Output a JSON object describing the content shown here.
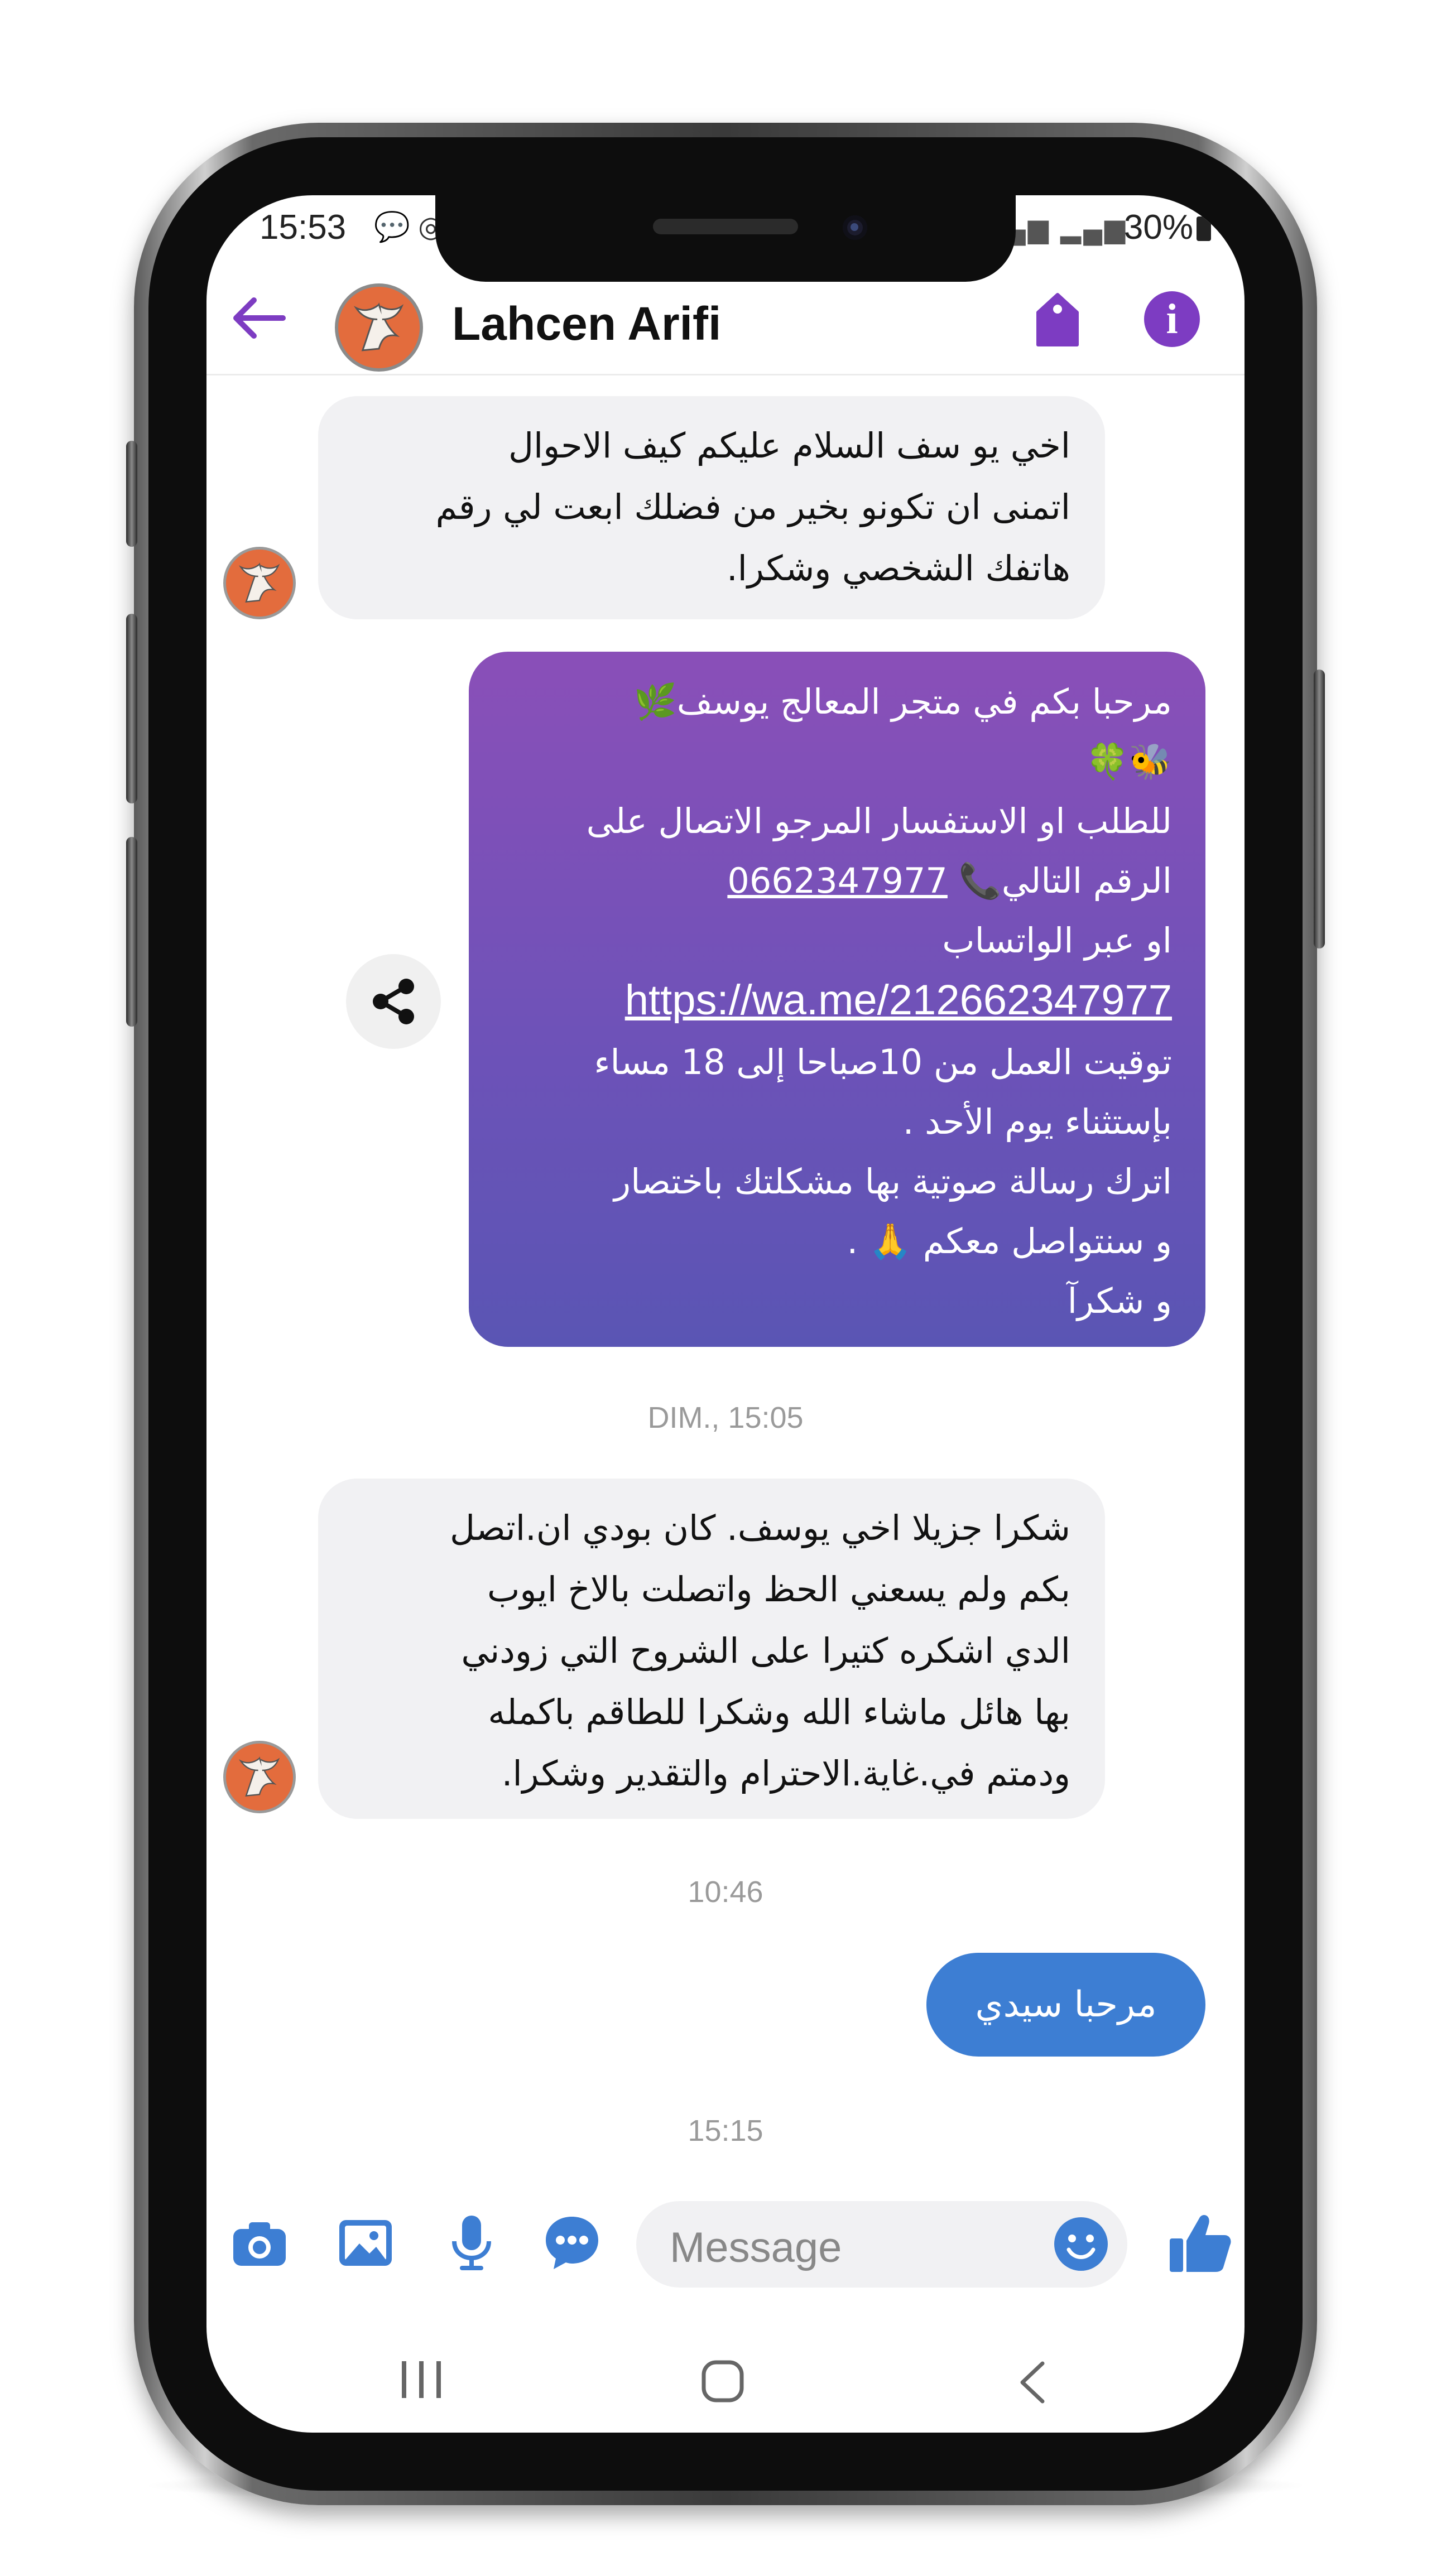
{
  "status_bar": {
    "time": "15:53",
    "battery": "30%"
  },
  "header": {
    "contact_name": "Lahcen Arifi"
  },
  "messages": [
    {
      "from": "contact",
      "lines": [
        "اخي يو سف السلام عليكم كيف الاحوال",
        "اتمنى ان تكونو بخير من فضلك ابعت لي رقم",
        "هاتفك الشخصي وشكرا."
      ]
    },
    {
      "from": "me",
      "line1": "مرحبا بكم في متجر المعالج يوسف🌿",
      "line2": "🐝🍀",
      "line3": "للطلب او الاستفسار المرجو الاتصال على",
      "line4_prefix": "الرقم التالي📞 ",
      "phone": "0662347977",
      "line5": "او عبر الواتساب",
      "url": "https://wa.me/212662347977",
      "line7": "توقيت العمل من 10صباحا إلى 18 مساء",
      "line8": "بإستثناء يوم الأحد .",
      "line9": "اترك رسالة صوتية بها مشكلتك باختصار",
      "line10": "و سنتواصل معكم 🙏 .",
      "line11": "و شكرآ"
    },
    {
      "from": "contact",
      "lines": [
        "شكرا جزيلا اخي يوسف. كان بودي ان.اتصل",
        "بكم  ولم يسعني الحظ واتصلت بالاخ ايوب",
        "الدي اشكره كتيرا على الشروح التي زودني",
        "بها هائل ماشاء الله وشكرا للطاقم باكمله",
        "ودمتم في.غاية.الاحترام والتقدير وشكرا."
      ]
    },
    {
      "from": "me",
      "text": "مرحبا  سيدي"
    }
  ],
  "timestamps": [
    "DIM., 15:05",
    "10:46",
    "15:15"
  ],
  "composer": {
    "placeholder": "Message"
  },
  "colors": {
    "accent": "#7d3cc2",
    "outgoing_blue": "#3d7ed3",
    "composer_icons": "#3d7ed3"
  }
}
